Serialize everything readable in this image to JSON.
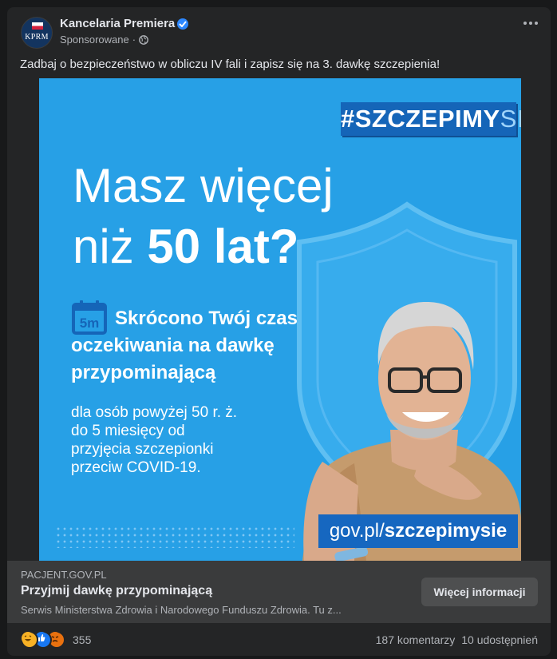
{
  "post": {
    "page_name": "Kancelaria Premiera",
    "avatar_text": "KPRM",
    "sponsored": "Sponsorowane",
    "separator": "·",
    "caption": "Zadbaj o bezpieczeństwo w obliczu IV fali i zapisz się na 3. dawkę szczepienia!"
  },
  "creative": {
    "hashtag_main": "#SZCZEPIMY",
    "hashtag_end": "SIĘ",
    "headline_line1": "Masz więcej",
    "headline_line2_a": "niż ",
    "headline_line2_b": "50 lat?",
    "calendar_text": "5m",
    "sub_line1": "Skrócono Twój czas",
    "sub_line2": "oczekiwania na dawkę",
    "sub_line3": "przypominającą",
    "body_line1": "dla osób powyżej 50 r. ż.",
    "body_line2": "do 5 miesięcy od",
    "body_line3": "przyjęcia szczepionki",
    "body_line4": "przeciw COVID-19.",
    "url_a": "gov.pl/",
    "url_b": "szczepimysie"
  },
  "link": {
    "domain": "PACJENT.GOV.PL",
    "title": "Przyjmij dawkę przypominającą",
    "description": "Serwis Ministerstwa Zdrowia i Narodowego Funduszu Zdrowia. Tu z...",
    "cta": "Więcej informacji"
  },
  "engagement": {
    "reactions_count": "355",
    "comments": "187 komentarzy",
    "shares": "10 udostępnień"
  },
  "colors": {
    "background": "#18191a",
    "card": "#242526",
    "creative_blue": "#27a0e6",
    "accent_blue": "#1565b8",
    "verified": "#2d88ff"
  },
  "icons": [
    "verified-badge-icon",
    "globe-icon",
    "more-options-icon",
    "calendar-icon",
    "haha-reaction-icon",
    "like-reaction-icon",
    "angry-reaction-icon"
  ]
}
